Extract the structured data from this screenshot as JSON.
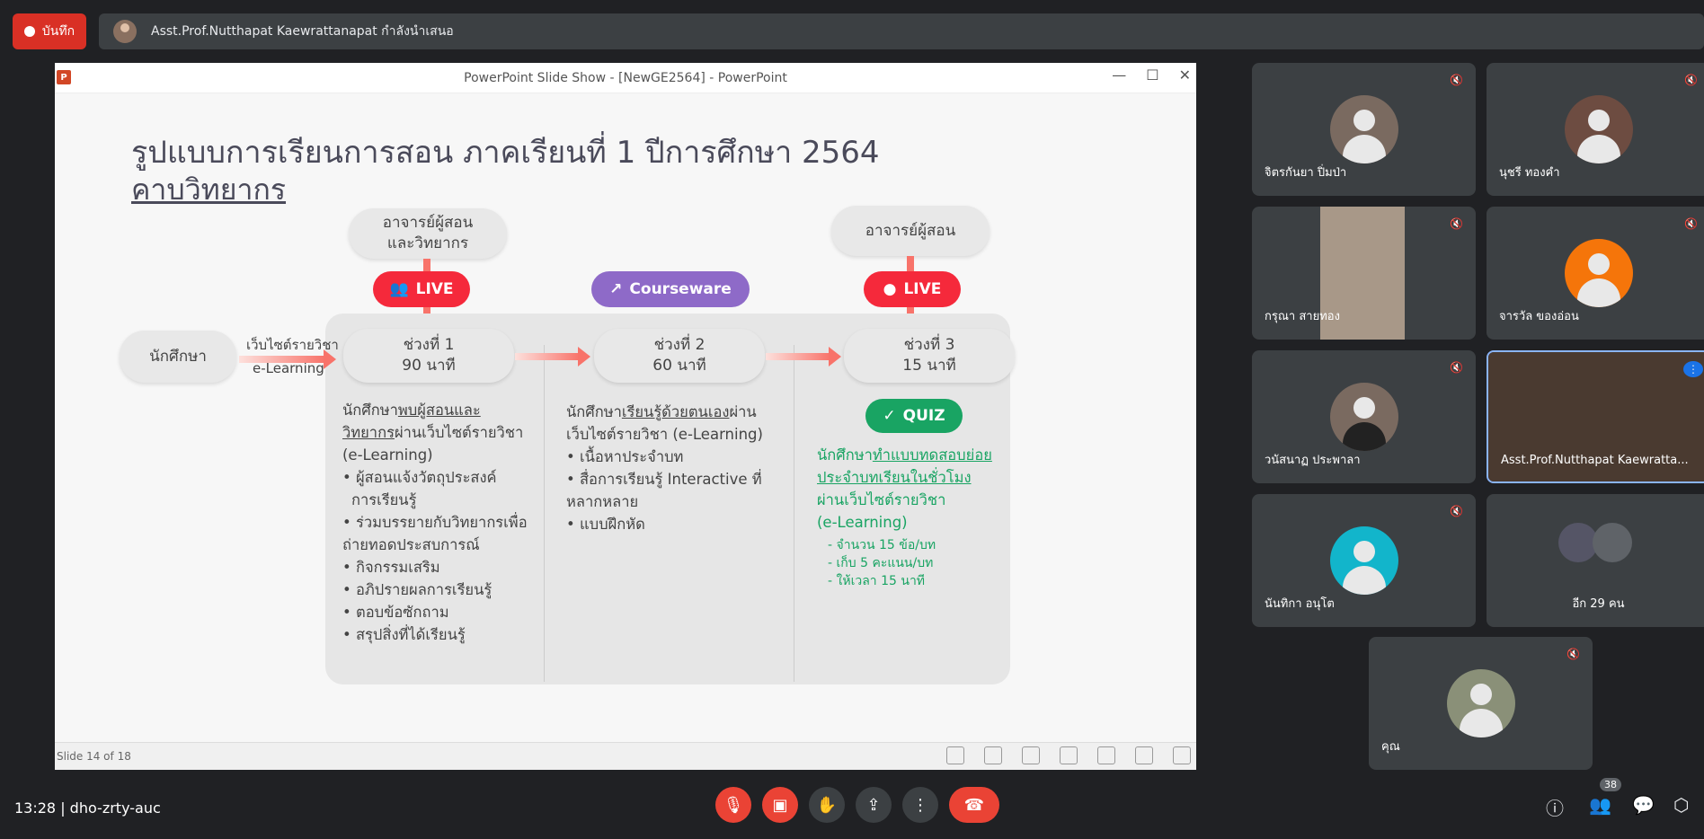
{
  "top": {
    "record_label": "บันทึก",
    "presenter_text": "Asst.Prof.Nutthapat Kaewrattanapat กำลังนำเสนอ"
  },
  "ppt": {
    "window_title": "PowerPoint Slide Show - [NewGE2564] - PowerPoint",
    "icon_letter": "P",
    "min": "—",
    "max": "☐",
    "close": "✕",
    "status": "Slide 14 of 18"
  },
  "slide": {
    "title": "รูปแบบการเรียนการสอน  ภาคเรียนที่ 1 ปีการศึกษา 2564",
    "subtitle": "คาบวิทยากร",
    "top_left_pill": [
      "อาจารย์ผู้สอน",
      "และวิทยากร"
    ],
    "top_right_pill": "อาจารย์ผู้สอน",
    "live1": "LIVE",
    "courseware": "Courseware",
    "live2": "LIVE",
    "student": "นักศึกษา",
    "web_label": "เว็บไซต์รายวิชา",
    "elearning_label": "e-Learning",
    "p1": [
      "ช่วงที่ 1",
      "90 นาที"
    ],
    "p2": [
      "ช่วงที่ 2",
      "60 นาที"
    ],
    "p3": [
      "ช่วงที่ 3",
      "15 นาที"
    ],
    "quiz": "QUIZ",
    "col1": {
      "intro_a": "นักศึกษา",
      "intro_b": "พบผู้สอนและ",
      "intro_c": "วิทยากร",
      "intro_d": "ผ่านเว็บไซต์รายวิชา",
      "intro_e": "(e-Learning)",
      "bullets": [
        "• ผู้สอนแจ้งวัตถุประสงค์",
        "  การเรียนรู้",
        "• ร่วมบรรยายกับวิทยากรเพื่อ",
        "ถ่ายทอดประสบการณ์",
        "• กิจกรรมเสริม",
        "• อภิปรายผลการเรียนรู้",
        "• ตอบข้อซักถาม",
        "• สรุปสิ่งที่ได้เรียนรู้"
      ]
    },
    "col2": {
      "intro_a": "นักศึกษา",
      "intro_b": "เรียนรู้ด้วยตนเอง",
      "intro_c": "ผ่าน",
      "intro_d": "เว็บไซต์รายวิชา (e-Learning)",
      "bullets": [
        "• เนื้อหาประจำบท",
        "• สื่อการเรียนรู้ Interactive ที่",
        "หลากหลาย",
        "• แบบฝึกหัด"
      ]
    },
    "col3": {
      "a": "นักศึกษา",
      "b": "ทำแบบทดสอบย่อย",
      "c": "ประจำบทเรียนในชั่วโมง",
      "d": "ผ่านเว็บไซต์รายวิชา",
      "e": "(e-Learning)",
      "subs": [
        "-  จำนวน 15 ข้อ/บท",
        "-  เก็บ 5 คะแนน/บท",
        "-  ให้เวลา 15 นาที"
      ]
    }
  },
  "participants": [
    {
      "name": "จิตรกันยา ปิ่มป่า",
      "avatar": "photo-icon"
    },
    {
      "name": "นุชรี ทองคำ",
      "avatar": "default-avatar-icon"
    },
    {
      "name": "กรุณา สายทอง",
      "avatar": "video"
    },
    {
      "name": "จารวัล ของอ่อน",
      "avatar": "default-avatar-icon"
    },
    {
      "name": "วนัสนาฏ ประพาลา",
      "avatar": "photo-icon"
    },
    {
      "name": "Asst.Prof.Nutthapat Kaewratta...",
      "avatar": "video"
    },
    {
      "name": "นันทิกา อนุโต",
      "avatar": "default-avatar-icon"
    },
    {
      "name": "อีก 29 คน",
      "avatar": "group-icon"
    },
    {
      "name": "คุณ",
      "avatar": "photo-icon"
    }
  ],
  "bottom": {
    "time": "13:28",
    "meeting_code": "dho-zrty-auc",
    "participant_count": "38"
  },
  "colors": {
    "record": "#d93025",
    "live": "#f5293b",
    "courseware": "#8e6ac8",
    "quiz": "#19a463",
    "active_border": "#8ab4f8"
  }
}
